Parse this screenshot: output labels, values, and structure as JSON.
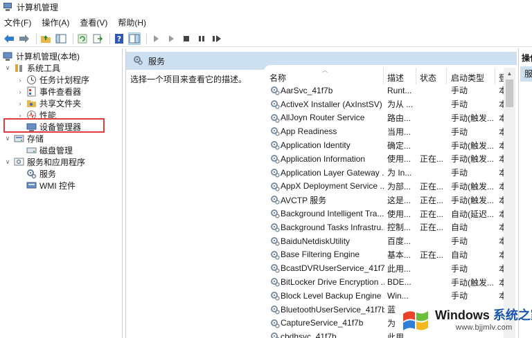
{
  "window": {
    "title": "计算机管理"
  },
  "menu": [
    "文件(F)",
    "操作(A)",
    "查看(V)",
    "帮助(H)"
  ],
  "tree": [
    {
      "label": "计算机管理(本地)",
      "arrow": "",
      "level": 0,
      "icon": "computer-management-icon"
    },
    {
      "label": "系统工具",
      "arrow": "∨",
      "level": 1,
      "icon": "system-tools-icon"
    },
    {
      "label": "任务计划程序",
      "arrow": "›",
      "level": 2,
      "icon": "task-scheduler-icon"
    },
    {
      "label": "事件查看器",
      "arrow": "›",
      "level": 2,
      "icon": "event-viewer-icon"
    },
    {
      "label": "共享文件夹",
      "arrow": "›",
      "level": 2,
      "icon": "shared-folders-icon"
    },
    {
      "label": "性能",
      "arrow": "›",
      "level": 2,
      "icon": "performance-icon"
    },
    {
      "label": "设备管理器",
      "arrow": "",
      "level": 2,
      "icon": "device-manager-icon"
    },
    {
      "label": "存储",
      "arrow": "∨",
      "level": 1,
      "icon": "storage-icon"
    },
    {
      "label": "磁盘管理",
      "arrow": "",
      "level": 2,
      "icon": "disk-management-icon"
    },
    {
      "label": "服务和应用程序",
      "arrow": "∨",
      "level": 1,
      "icon": "services-apps-icon"
    },
    {
      "label": "服务",
      "arrow": "",
      "level": 2,
      "icon": "services-gear-icon"
    },
    {
      "label": "WMI 控件",
      "arrow": "",
      "level": 2,
      "icon": "wmi-control-icon"
    }
  ],
  "center": {
    "header": "服务",
    "description_hint": "选择一个项目来查看它的描述。"
  },
  "columns": {
    "name": "名称",
    "desc": "描述",
    "status": "状态",
    "startup": "启动类型",
    "login": "登"
  },
  "services": [
    {
      "name": "AarSvc_41f7b",
      "desc": "Runt...",
      "status": "",
      "startup": "手动",
      "login": "本"
    },
    {
      "name": "ActiveX Installer (AxInstSV)",
      "desc": "为从 ...",
      "status": "",
      "startup": "手动",
      "login": "本"
    },
    {
      "name": "AllJoyn Router Service",
      "desc": "路由...",
      "status": "",
      "startup": "手动(触发...",
      "login": "本"
    },
    {
      "name": "App Readiness",
      "desc": "当用...",
      "status": "",
      "startup": "手动",
      "login": "本"
    },
    {
      "name": "Application Identity",
      "desc": "确定...",
      "status": "",
      "startup": "手动(触发...",
      "login": "本"
    },
    {
      "name": "Application Information",
      "desc": "使用...",
      "status": "正在...",
      "startup": "手动(触发...",
      "login": "本"
    },
    {
      "name": "Application Layer Gateway ...",
      "desc": "为 In...",
      "status": "",
      "startup": "手动",
      "login": "本"
    },
    {
      "name": "AppX Deployment Service ...",
      "desc": "为部...",
      "status": "正在...",
      "startup": "手动(触发...",
      "login": "本"
    },
    {
      "name": "AVCTP 服务",
      "desc": "这是...",
      "status": "正在...",
      "startup": "手动(触发...",
      "login": "本"
    },
    {
      "name": "Background Intelligent Tra...",
      "desc": "使用...",
      "status": "正在...",
      "startup": "自动(延迟...",
      "login": "本"
    },
    {
      "name": "Background Tasks Infrastru...",
      "desc": "控制...",
      "status": "正在...",
      "startup": "自动",
      "login": "本"
    },
    {
      "name": "BaiduNetdiskUtility",
      "desc": "百度...",
      "status": "",
      "startup": "手动",
      "login": "本"
    },
    {
      "name": "Base Filtering Engine",
      "desc": "基本...",
      "status": "正在...",
      "startup": "自动",
      "login": "本"
    },
    {
      "name": "BcastDVRUserService_41f7b",
      "desc": "此用...",
      "status": "",
      "startup": "手动",
      "login": "本"
    },
    {
      "name": "BitLocker Drive Encryption ...",
      "desc": "BDE...",
      "status": "",
      "startup": "手动(触发...",
      "login": "本"
    },
    {
      "name": "Block Level Backup Engine ...",
      "desc": "Win...",
      "status": "",
      "startup": "手动",
      "login": "本"
    },
    {
      "name": "BluetoothUserService_41f7b",
      "desc": "蓝",
      "status": "",
      "startup": "",
      "login": ""
    },
    {
      "name": "CaptureService_41f7b",
      "desc": "为",
      "status": "",
      "startup": "",
      "login": ""
    },
    {
      "name": "cbdhsvc_41f7b",
      "desc": "此用",
      "status": "",
      "startup": "",
      "login": ""
    }
  ],
  "actions": {
    "header": "操作",
    "item": "服务"
  },
  "watermark": {
    "brand": "Windows",
    "brand2": "系统之家",
    "url": "www.bjjmlv.com"
  },
  "colors": {
    "accent": "#1a56b0",
    "selection_box": "#e0393e",
    "header_bg": "#cde0f1"
  }
}
